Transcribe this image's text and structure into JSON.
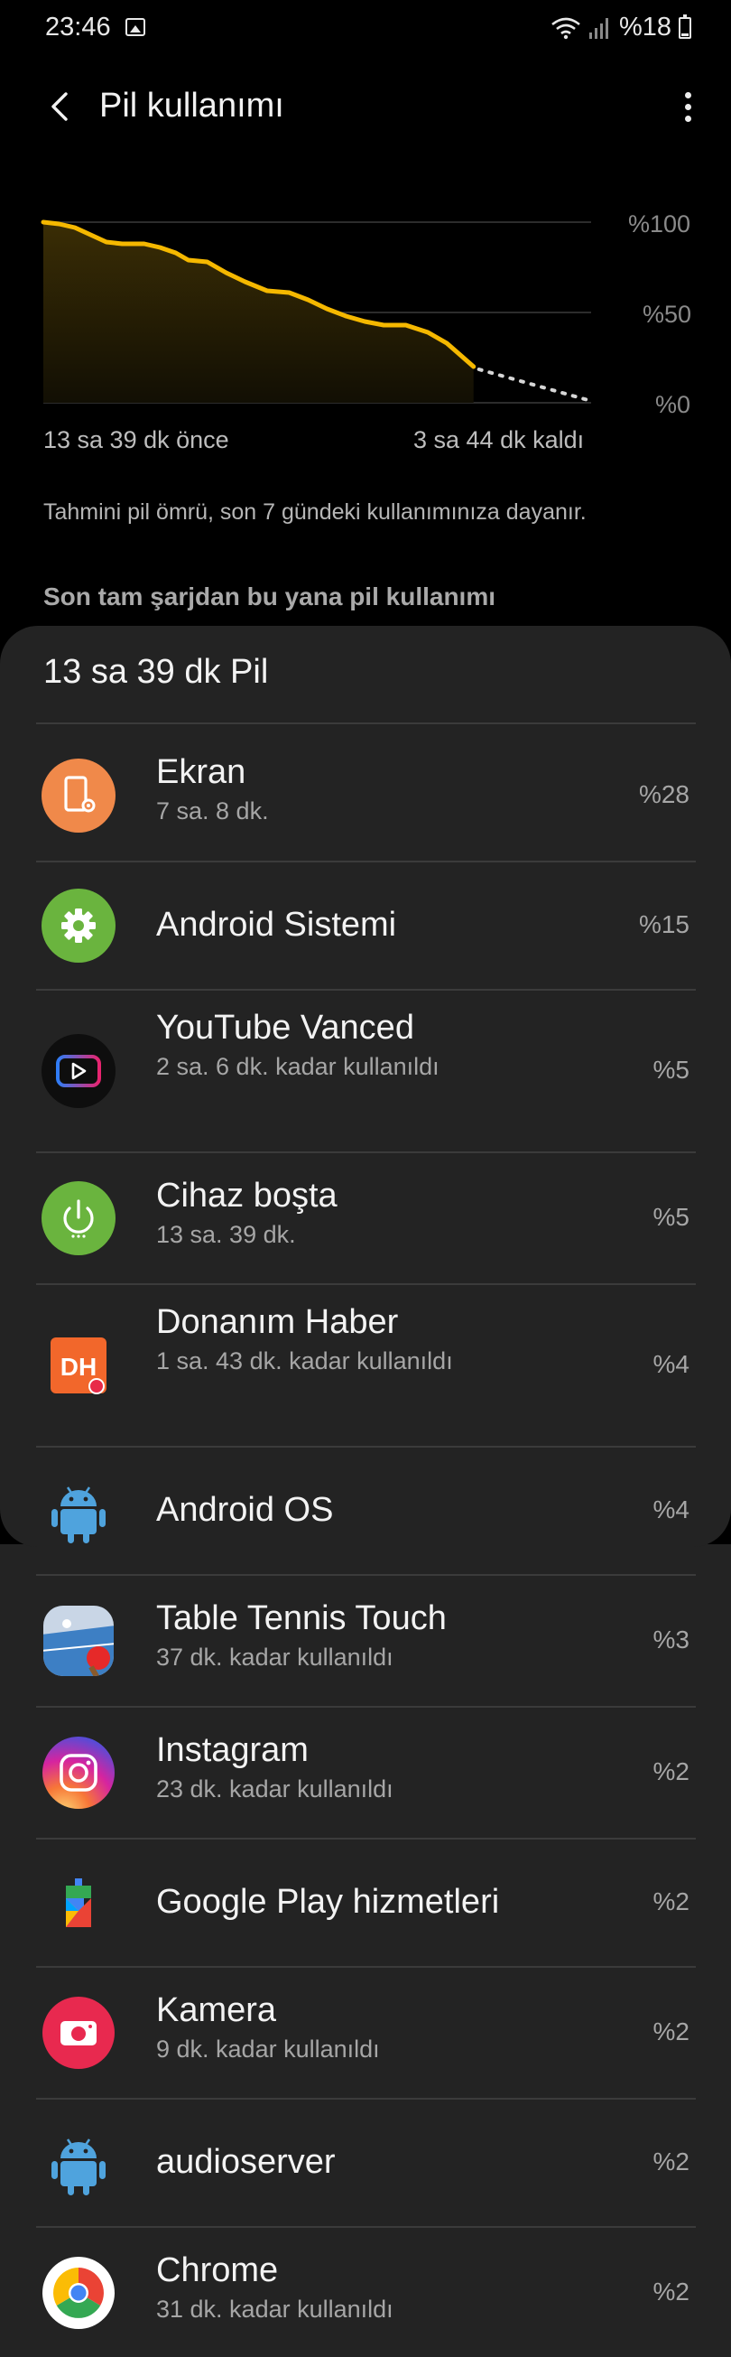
{
  "status_bar": {
    "time": "23:46",
    "battery_text": "%18",
    "icons": [
      "image-icon",
      "wifi-icon",
      "signal-icon",
      "battery-icon"
    ]
  },
  "app_bar": {
    "title": "Pil kullanımı",
    "back_icon": "back-arrow-icon",
    "menu_icon": "more-vert-icon"
  },
  "chart_data": {
    "type": "line",
    "y_ticks": [
      "%100",
      "%50",
      "%0"
    ],
    "ylim": [
      0,
      100
    ],
    "x_start_label": "13 sa 39 dk önce",
    "x_end_label": "3 sa 44 dk kaldı",
    "history_hours_ago": 13.65,
    "remaining_hours": 3.73,
    "series": [
      {
        "values": [
          {
            "h": 0.0,
            "pct": 100
          },
          {
            "h": 0.5,
            "pct": 99
          },
          {
            "h": 1.0,
            "pct": 97
          },
          {
            "h": 1.5,
            "pct": 93
          },
          {
            "h": 2.0,
            "pct": 89
          },
          {
            "h": 2.5,
            "pct": 88
          },
          {
            "h": 3.2,
            "pct": 88
          },
          {
            "h": 3.7,
            "pct": 86
          },
          {
            "h": 4.2,
            "pct": 83
          },
          {
            "h": 4.6,
            "pct": 79
          },
          {
            "h": 5.2,
            "pct": 78
          },
          {
            "h": 5.8,
            "pct": 72
          },
          {
            "h": 6.4,
            "pct": 67
          },
          {
            "h": 7.1,
            "pct": 62
          },
          {
            "h": 7.8,
            "pct": 61
          },
          {
            "h": 8.4,
            "pct": 57
          },
          {
            "h": 9.0,
            "pct": 52
          },
          {
            "h": 9.6,
            "pct": 48
          },
          {
            "h": 10.2,
            "pct": 45
          },
          {
            "h": 10.8,
            "pct": 43
          },
          {
            "h": 11.5,
            "pct": 43
          },
          {
            "h": 12.2,
            "pct": 39
          },
          {
            "h": 12.8,
            "pct": 33
          },
          {
            "h": 13.65,
            "pct": 20
          }
        ]
      }
    ],
    "projection_end_pct": 0,
    "colors": {
      "line": "#f5b800",
      "projection": "#d6d6d6",
      "grid": "#3a3a3a"
    }
  },
  "note": "Tahmini pil ömrü, son 7 gündeki kullanımınıza dayanır.",
  "section_title": "Son tam şarjdan bu yana pil kullanımı",
  "usage_card": {
    "title": "13 sa 39 dk Pil",
    "items": [
      {
        "name": "Ekran",
        "sub": "7 sa. 8 dk.",
        "pct": "%28",
        "icon": "screen-settings-icon",
        "color": "#f0894a"
      },
      {
        "name": "Android Sistemi",
        "sub": "",
        "pct": "%15",
        "icon": "gear-icon",
        "color": "#6ab43e"
      },
      {
        "name": "YouTube Vanced",
        "sub": "2 sa. 6 dk. kadar kullanıldı",
        "pct": "%5",
        "icon": "youtube-vanced-icon",
        "color": "#1a1a1a"
      },
      {
        "name": "Cihaz boşta",
        "sub": "13 sa. 39 dk.",
        "pct": "%5",
        "icon": "power-icon",
        "color": "#6ab43e"
      },
      {
        "name": "Donanım Haber",
        "sub": "1 sa. 43 dk. kadar kullanıldı",
        "pct": "%4",
        "icon": "dh-logo-icon",
        "color": "#f2672b",
        "logo_text": "DH"
      },
      {
        "name": "Android OS",
        "sub": "",
        "pct": "%4",
        "icon": "android-robot-icon",
        "color": "#4fa3dd"
      },
      {
        "name": "Table Tennis Touch",
        "sub": "37 dk. kadar kullanıldı",
        "pct": "%3",
        "icon": "table-tennis-icon",
        "color": "#3d7fc4"
      },
      {
        "name": "Instagram",
        "sub": "23 dk. kadar kullanıldı",
        "pct": "%2",
        "icon": "instagram-icon",
        "color": "#d6249f"
      },
      {
        "name": "Google Play hizmetleri",
        "sub": "",
        "pct": "%2",
        "icon": "play-services-icon",
        "color": "#34a853"
      },
      {
        "name": "Kamera",
        "sub": "9 dk. kadar kullanıldı",
        "pct": "%2",
        "icon": "camera-icon",
        "color": "#e8294f"
      },
      {
        "name": "audioserver",
        "sub": "",
        "pct": "%2",
        "icon": "android-robot-icon",
        "color": "#4fa3dd"
      },
      {
        "name": "Chrome",
        "sub": "31 dk. kadar kullanıldı",
        "pct": "%2",
        "icon": "chrome-icon",
        "color": "#ffffff"
      }
    ]
  }
}
